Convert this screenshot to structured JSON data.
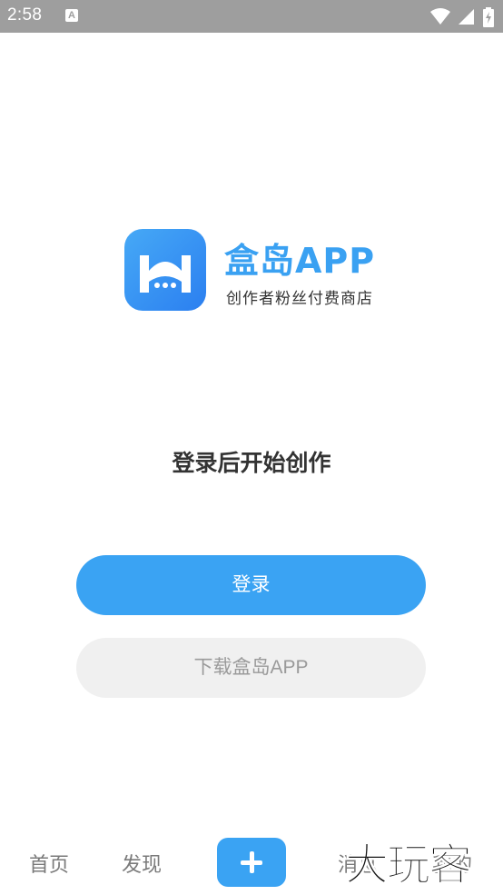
{
  "status_bar": {
    "time": "2:58",
    "notification_icon": "A"
  },
  "brand": {
    "name": "盒岛APP",
    "tagline": "创作者粉丝付费商店",
    "accent_color": "#3aa3f3"
  },
  "prompt": "登录后开始创作",
  "buttons": {
    "login": "登录",
    "download": "下载盒岛APP"
  },
  "bottom_nav": {
    "home": "首页",
    "discover": "发现",
    "add_icon": "plus-icon",
    "messages": "消息",
    "mine": "我的"
  },
  "watermark": "大玩客"
}
